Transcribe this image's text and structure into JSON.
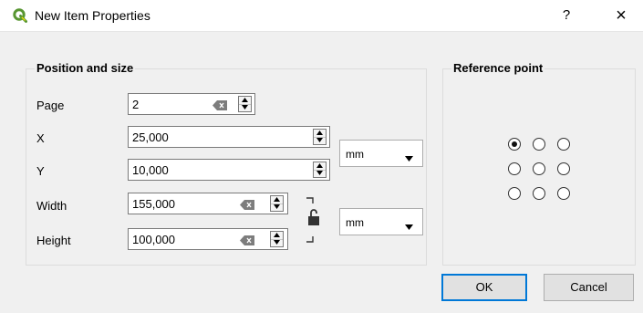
{
  "window": {
    "title": "New Item Properties",
    "help_label": "?",
    "close_label": "×"
  },
  "position_group": {
    "title": "Position and size",
    "fields": {
      "page": {
        "label": "Page",
        "value": "2"
      },
      "x": {
        "label": "X",
        "value": "25,000"
      },
      "y": {
        "label": "Y",
        "value": "10,000"
      },
      "width": {
        "label": "Width",
        "value": "155,000"
      },
      "height": {
        "label": "Height",
        "value": "100,000"
      }
    },
    "position_units": "mm",
    "size_units": "mm"
  },
  "reference_group": {
    "title": "Reference point",
    "selected": "upper-left"
  },
  "buttons": {
    "ok": "OK",
    "cancel": "Cancel"
  },
  "colors": {
    "logo_green": "#589632",
    "logo_yellow": "#ffe700",
    "default_button_border": "#0078d7"
  },
  "icons": [
    "qgis-logo-icon",
    "help-icon",
    "close-icon",
    "clear-icon",
    "spin-up-icon",
    "spin-down-icon",
    "lock-icon",
    "dropdown-arrow-icon"
  ]
}
